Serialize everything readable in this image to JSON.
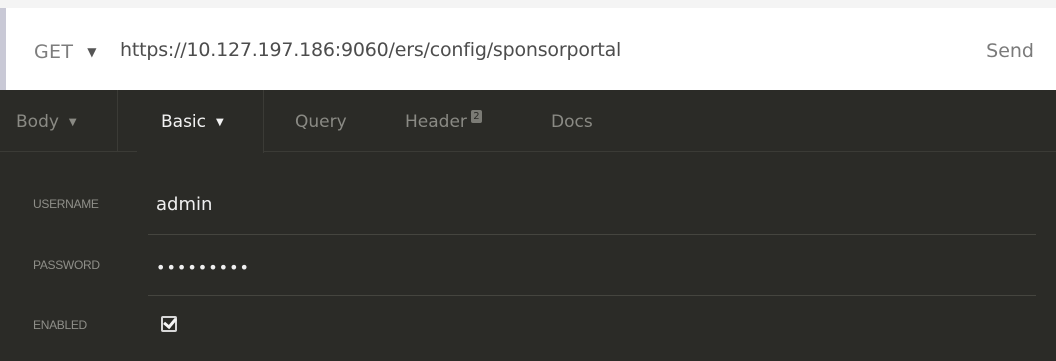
{
  "request": {
    "method": "GET",
    "url": "https://10.127.197.186:9060/ers/config/sponsorportal",
    "send_label": "Send"
  },
  "tabs": [
    {
      "label": "Body",
      "active": false,
      "has_caret": true
    },
    {
      "label": "Basic",
      "active": true,
      "has_caret": true
    },
    {
      "label": "Query",
      "active": false
    },
    {
      "label": "Header",
      "active": false,
      "badge": "2"
    },
    {
      "label": "Docs",
      "active": false
    }
  ],
  "auth": {
    "username_label": "USERNAME",
    "username_value": "admin",
    "password_label": "PASSWORD",
    "password_value": "•••••••••",
    "enabled_label": "ENABLED",
    "enabled_checked": true
  },
  "colors": {
    "panel_bg": "#2b2b27",
    "active_tab_text": "#f2f2f2",
    "inactive_tab_text": "#8a8a84"
  }
}
